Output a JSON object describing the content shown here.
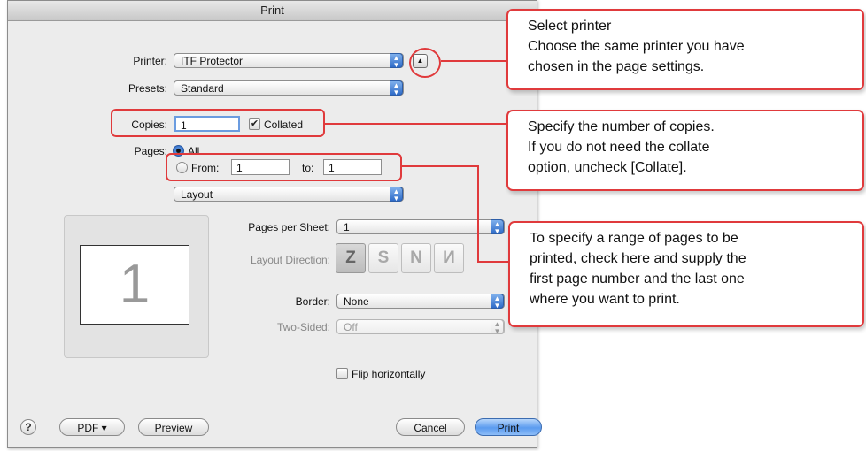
{
  "window": {
    "title": "Print"
  },
  "printer": {
    "label": "Printer:",
    "value": "ITF Protector"
  },
  "presets": {
    "label": "Presets:",
    "value": "Standard"
  },
  "copies": {
    "label": "Copies:",
    "value": "1",
    "collated_label": "Collated",
    "collated_checked": true
  },
  "pages": {
    "label": "Pages:",
    "all_label": "All",
    "from_label": "From:",
    "from_value": "1",
    "to_label": "to:",
    "to_value": "1"
  },
  "section": {
    "value": "Layout"
  },
  "preview": {
    "page_number": "1"
  },
  "layout": {
    "pages_per_sheet_label": "Pages per Sheet:",
    "pages_per_sheet_value": "1",
    "direction_label": "Layout Direction:",
    "border_label": "Border:",
    "border_value": "None",
    "two_sided_label": "Two-Sided:",
    "two_sided_value": "Off",
    "flip_label": "Flip horizontally"
  },
  "buttons": {
    "help": "?",
    "pdf": "PDF ▾",
    "preview": "Preview",
    "cancel": "Cancel",
    "print": "Print"
  },
  "callouts": {
    "printer": [
      "Select printer",
      "Choose the same printer you have",
      "chosen in the page settings."
    ],
    "copies": [
      "Specify the number of copies.",
      "If you do not need the collate",
      "option, uncheck [Collate]."
    ],
    "range": [
      "To specify a range of pages to be",
      "printed, check here and supply the",
      "first page number and the last one",
      "where you want to print."
    ]
  },
  "colors": {
    "highlight": "#e03a3c",
    "accent": "#2f6cc8"
  }
}
